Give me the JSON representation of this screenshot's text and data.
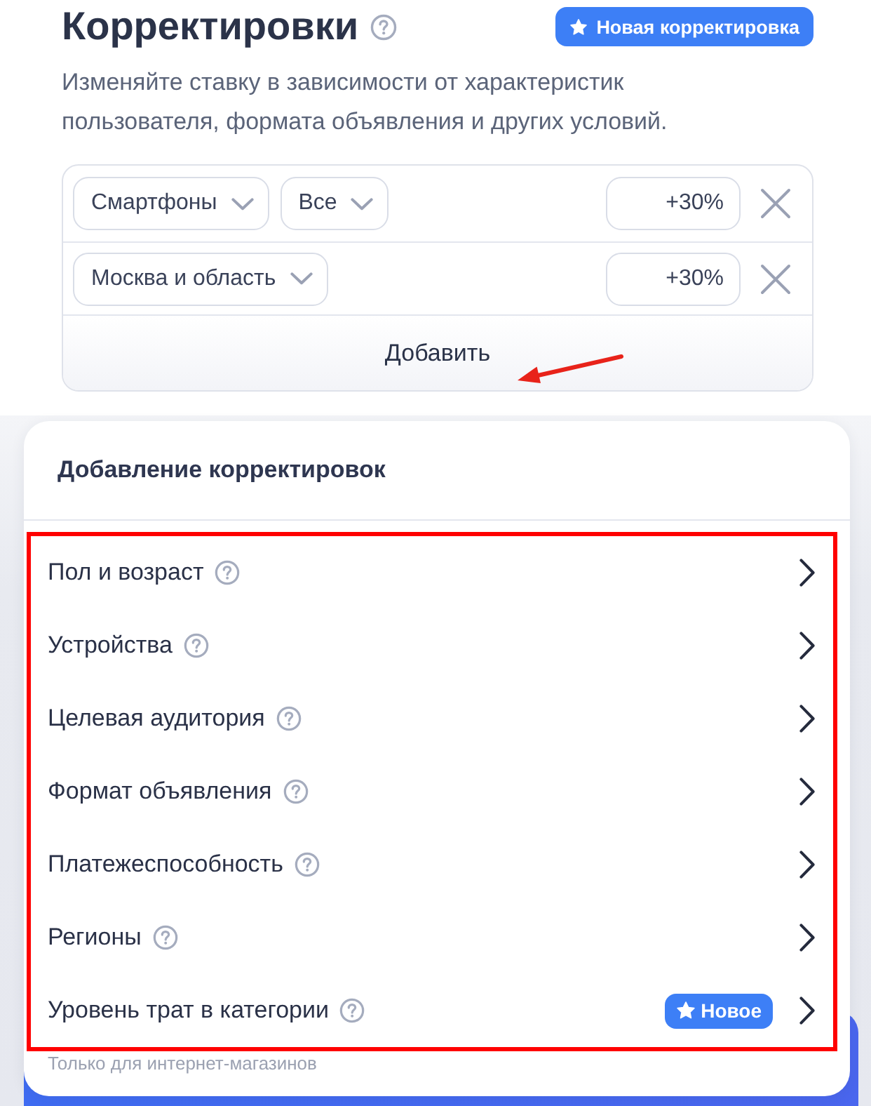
{
  "header": {
    "title": "Корректировки",
    "new_button": "Новая корректировка",
    "description": "Изменяйте ставку в зависимости от характеристик пользователя, формата объявления и других условий."
  },
  "adjustments": {
    "rows": [
      {
        "selects": [
          "Смартфоны",
          "Все"
        ],
        "value": "+30%"
      },
      {
        "selects": [
          "Москва и область"
        ],
        "value": "+30%"
      }
    ],
    "add_button": "Добавить"
  },
  "popup": {
    "title": "Добавление корректировок",
    "items": [
      {
        "label": "Пол и возраст"
      },
      {
        "label": "Устройства"
      },
      {
        "label": "Целевая аудитория"
      },
      {
        "label": "Формат объявления"
      },
      {
        "label": "Платежеспособность"
      },
      {
        "label": "Регионы"
      },
      {
        "label": "Уровень трат в категории",
        "badge": "Новое",
        "note": "Только для интернет-магазинов"
      }
    ]
  }
}
